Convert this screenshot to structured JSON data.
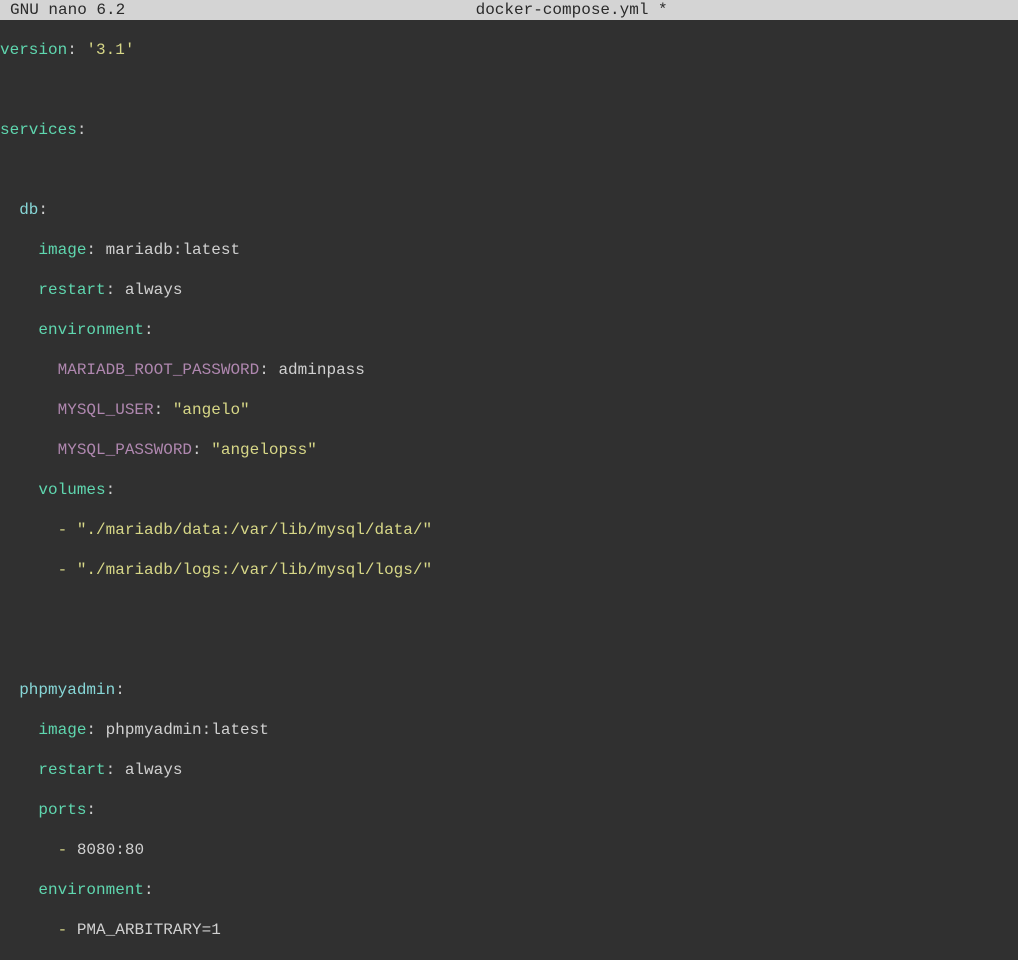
{
  "titlebar": {
    "app": "GNU nano 6.2",
    "filename": "docker-compose.yml *"
  },
  "yaml": {
    "version_key": "version",
    "version_val": "'3.1'",
    "services_key": "services",
    "db": {
      "name": "db",
      "image_key": "image",
      "image_val": "mariadb:latest",
      "restart_key": "restart",
      "restart_val": "always",
      "environment_key": "environment",
      "env": {
        "root_pw_key": "MARIADB_ROOT_PASSWORD",
        "root_pw_val": "adminpass",
        "user_key": "MYSQL_USER",
        "user_val": "\"angelo\"",
        "pw_key": "MYSQL_PASSWORD",
        "pw_val": "\"angelopss\""
      },
      "volumes_key": "volumes",
      "vol1": "\"./mariadb/data:/var/lib/mysql/data/\"",
      "vol2": "\"./mariadb/logs:/var/lib/mysql/logs/\""
    },
    "pma": {
      "name": "phpmyadmin",
      "image_key": "image",
      "image_val": "phpmyadmin:latest",
      "restart_key": "restart",
      "restart_val": "always",
      "ports_key": "ports",
      "port1": "8080:80",
      "environment_key": "environment",
      "env1": "PMA_ARBITRARY=1"
    }
  }
}
